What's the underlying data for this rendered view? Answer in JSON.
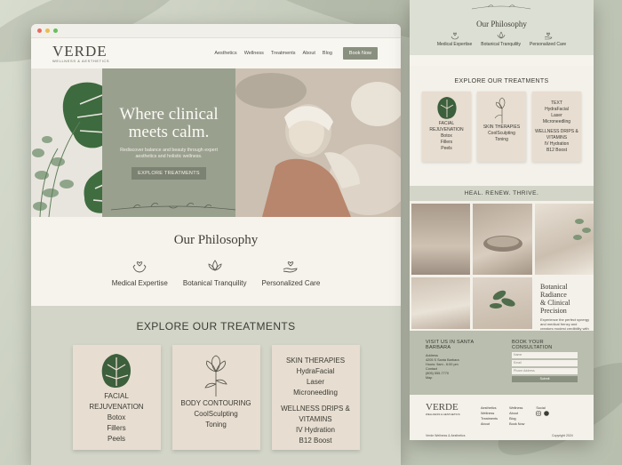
{
  "brand": {
    "name": "VERDE",
    "tagline": "WELLNESS & AESTHETICS"
  },
  "nav": {
    "links": [
      "Aesthetics",
      "Wellness",
      "Treatments",
      "About",
      "Blog"
    ],
    "cta": "Book Now"
  },
  "hero": {
    "title_line1": "Where clinical",
    "title_line2": "meets calm.",
    "subtitle": "Rediscover balance and beauty through expert aesthetics and holistic wellness.",
    "cta": "EXPLORE TREATMENTS"
  },
  "philosophy": {
    "title": "Our Philosophy",
    "items": [
      {
        "label": "Medical Expertise",
        "icon": "hands-heart-icon"
      },
      {
        "label": "Botanical Tranquility",
        "icon": "lotus-icon"
      },
      {
        "label": "Personalized Care",
        "icon": "hand-heart-icon"
      }
    ]
  },
  "treatments": {
    "title": "EXPLORE OUR TREATMENTS",
    "cards": [
      {
        "lines": [
          "FACIAL",
          "REJUVENATION",
          "Botox",
          "Fillers",
          "Peels"
        ],
        "icon": "monstera-leaf-icon"
      },
      {
        "lines": [
          "BODY CONTOURING",
          "CoolSculpting",
          "Toning"
        ],
        "icon": "flower-sketch-icon"
      },
      {
        "lines": [
          "SKIN THERAPIES",
          "HydraFacial",
          "Laser",
          "Microneedling",
          "",
          "WELLNESS DRIPS &",
          "VITAMINS",
          "IV Hydration",
          "B12 Boost"
        ],
        "icon": ""
      }
    ]
  },
  "mobile": {
    "philosophy_title": "Our Philosophy",
    "philosophy_items": [
      "Medical Expertise",
      "Botanical Tranquility",
      "Personalized Care"
    ],
    "treatments_title": "EXPLORE OUR TREATMENTS",
    "cards": [
      {
        "lines": [
          "FACIAL",
          "REJUVENATION",
          "Botox",
          "Fillers",
          "Peels"
        ]
      },
      {
        "lines": [
          "SKIN THERAPIES",
          "CoolSculpting",
          "Toning"
        ]
      },
      {
        "lines": [
          "TEXT",
          "HydraFacial",
          "Laser",
          "Microneedling",
          "",
          "WELLNESS DRIPS &",
          "VITAMINS",
          "IV Hydration",
          "B12 Boost"
        ]
      }
    ],
    "band": "HEAL. RENEW. THRIVE.",
    "feature_title_1": "Botanical Radiance",
    "feature_title_2": "& Clinical Precision",
    "feature_text": "Experience the perfect synergy and medical frenzy and creators modest credibility with wellness aesthetics and holistic wellness.",
    "visit_title": "VISIT US IN SANTA BARBARA",
    "visit_lines": [
      "Address",
      "4205 S Santa Barbara",
      "Hours: 9am - 6:00 pm",
      "Contact",
      "(805) 555-7770",
      "Map"
    ],
    "consult_title": "BOOK YOUR CONSULTATION",
    "form": {
      "name": "Name",
      "email": "Email",
      "phone": "Phone Address",
      "submit": "Submit"
    },
    "footer_cols": [
      [
        "Aesthetics",
        "Wellness",
        "Treatments",
        "About"
      ],
      [
        "Wellness",
        "About",
        "Blog",
        "Book Now"
      ],
      [
        "Social"
      ]
    ],
    "copyright": "Verde Wellness & Aesthetics",
    "year": "Copyright 2024"
  },
  "colors": {
    "sage": "#9aa08e",
    "cream": "#f6f3ec",
    "sand": "#e7ddd0",
    "olive_btn": "#8a907f"
  }
}
